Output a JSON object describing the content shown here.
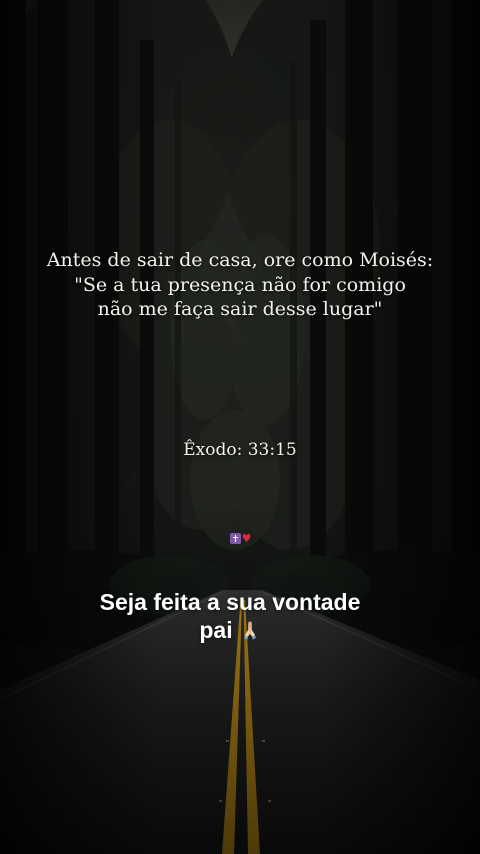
{
  "quote": {
    "line1": "Antes de sair de casa, ore como Moisés:",
    "line2": "\"Se a tua presença não for comigo",
    "line3": "não me faça sair desse lugar\""
  },
  "verse_reference": "Êxodo: 33:15",
  "emoji_row": {
    "icons": [
      "latin-cross-icon",
      "red-heart-icon"
    ],
    "heart_glyph": "♥"
  },
  "caption": {
    "line1": "Seja feita a sua vontade",
    "line2": "pai",
    "icon": "praying-hands-icon"
  },
  "colors": {
    "road_line": "#d9a21c",
    "text": "#f2f2ee",
    "heart": "#e0283c",
    "cross_box": "#7d5aa8"
  }
}
